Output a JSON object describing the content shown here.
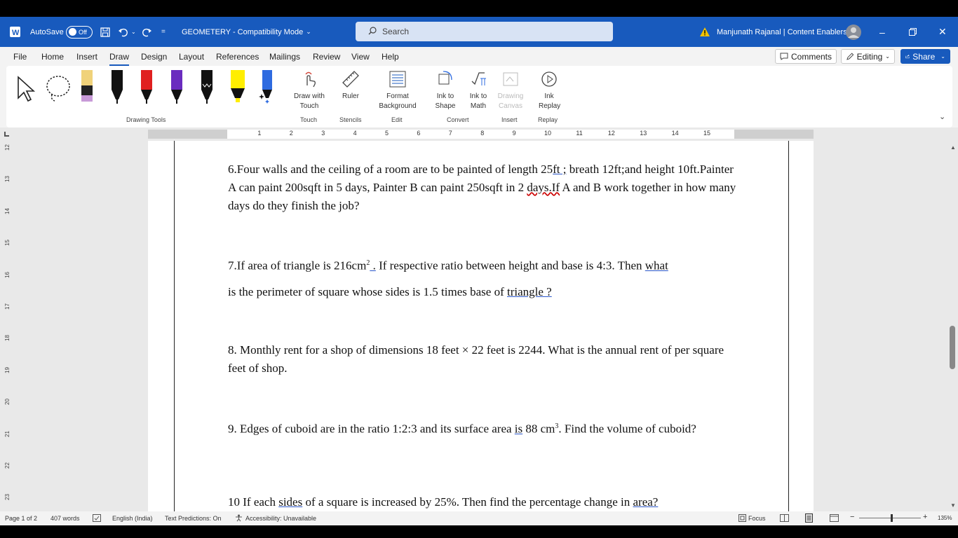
{
  "titlebar": {
    "autosave_label": "AutoSave",
    "autosave_state": "Off",
    "doc_title": "GEOMETERY  -  Compatibility Mode",
    "search_placeholder": "Search",
    "user_name": "Manjunath Rajanal | Content Enablers",
    "accent": "#185abd"
  },
  "menu": {
    "tabs": [
      "File",
      "Home",
      "Insert",
      "Draw",
      "Design",
      "Layout",
      "References",
      "Mailings",
      "Review",
      "View",
      "Help"
    ],
    "active_tab": "Draw",
    "comments_label": "Comments",
    "editing_label": "Editing",
    "share_label": "Share"
  },
  "ribbon": {
    "draw_with_touch": "Draw with Touch",
    "ruler": "Ruler",
    "format_background": "Format Background",
    "ink_to_shape": "Ink to Shape",
    "ink_to_math": "Ink to Math",
    "drawing_canvas": "Drawing Canvas",
    "ink_replay": "Ink Replay",
    "groups": {
      "drawing_tools": "Drawing Tools",
      "touch": "Touch",
      "stencils": "Stencils",
      "edit": "Edit",
      "convert": "Convert",
      "insert": "Insert",
      "replay": "Replay"
    }
  },
  "ruler": {
    "numbers": [
      "1",
      "2",
      "3",
      "4",
      "5",
      "6",
      "7",
      "8",
      "9",
      "10",
      "11",
      "12",
      "13",
      "14",
      "15"
    ],
    "vnumbers": [
      "12",
      "13",
      "14",
      "15",
      "16",
      "17",
      "18",
      "19",
      "20",
      "21",
      "22",
      "23"
    ]
  },
  "document": {
    "q6": {
      "a": "6.Four walls and the ceiling of a room are to be painted of length 25",
      "b": "ft ;",
      "c": " breath 12ft;and height 10ft.Painter A can paint 200sqft in 5 days, Painter B can paint 250sqft in 2 ",
      "d": "days.If",
      "e": " A and B work together in how many days do they finish the job?"
    },
    "q7": {
      "a": "7.If area of triangle is 216cm",
      "sup": "2",
      "b": " .",
      "c": " If respective ratio between height and base is 4:3. Then ",
      "d": "what",
      "line2a": "is the perimeter of square whose sides is 1.5 times base of ",
      "line2b": "triangle ?"
    },
    "q8": "8. Monthly rent for a shop of dimensions 18 feet × 22 feet is 2244. What is the annual rent of per square feet of shop.",
    "q9": {
      "a": "9. Edges of cuboid are in the ratio 1:2:3 and its surface area ",
      "b": "is",
      "c": " 88 cm",
      "sup": "3",
      "d": ". Find the volume of cuboid?"
    },
    "q10": {
      "a": "10 If each ",
      "b": "sides",
      "c": " of a square is increased by 25%. Then find the percentage change in ",
      "d": "area?"
    }
  },
  "status": {
    "page": "Page 1 of 2",
    "words": "407 words",
    "language": "English (India)",
    "predictions": "Text Predictions: On",
    "accessibility": "Accessibility: Unavailable",
    "focus": "Focus",
    "zoom": "135%"
  }
}
